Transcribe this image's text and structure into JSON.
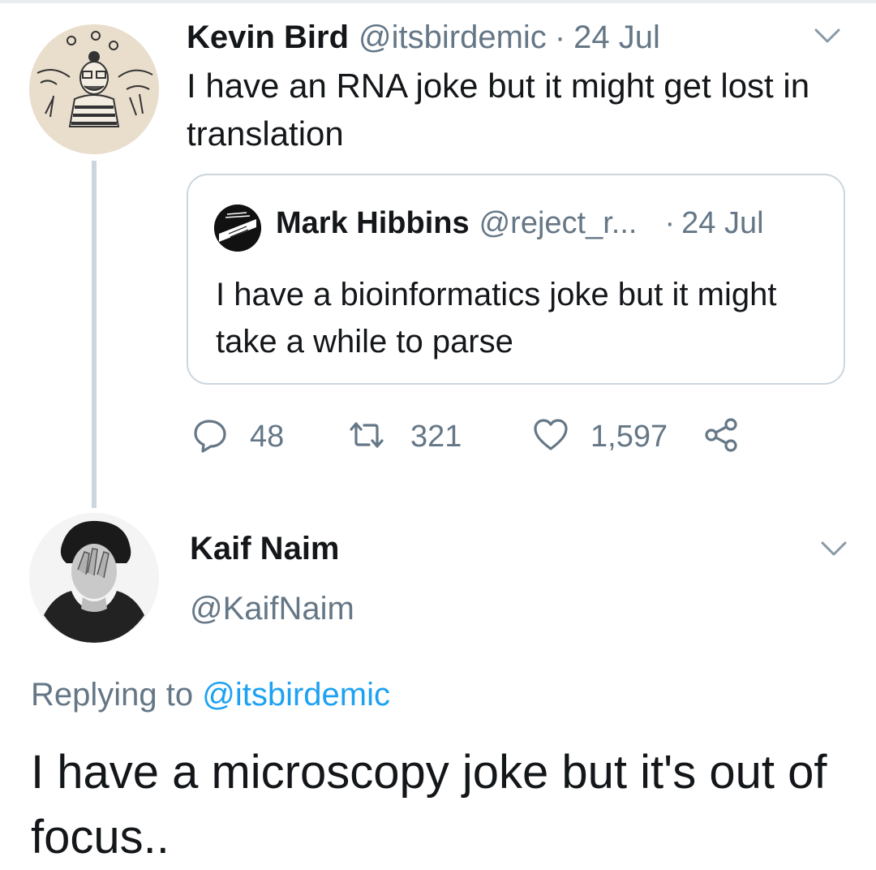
{
  "tweet": {
    "author_name": "Kevin Bird",
    "author_handle": "@itsbirdemic",
    "separator": "·",
    "date": "24 Jul",
    "text": "I have an RNA joke but it might get lost in translation",
    "quoted": {
      "author_name": "Mark Hibbins",
      "author_handle": "@reject_r...",
      "separator": "·",
      "date": "24 Jul",
      "text": "I have a bioinformatics joke but it might take a while to parse"
    },
    "stats": {
      "replies": "48",
      "retweets": "321",
      "likes": "1,597"
    }
  },
  "reply": {
    "author_name": "Kaif Naim",
    "author_handle": "@KaifNaim",
    "replying_label": "Replying to",
    "replying_to": "@itsbirdemic",
    "text": "I have a microscopy joke but it's out of focus.."
  },
  "icons": {
    "reply": "speech-bubble-icon",
    "retweet": "retweet-icon",
    "like": "heart-icon",
    "share": "share-icon",
    "menu": "chevron-down-icon"
  },
  "colors": {
    "text": "#14171a",
    "secondary": "#657786",
    "link": "#1da1f2",
    "border": "#ccd6dd"
  }
}
